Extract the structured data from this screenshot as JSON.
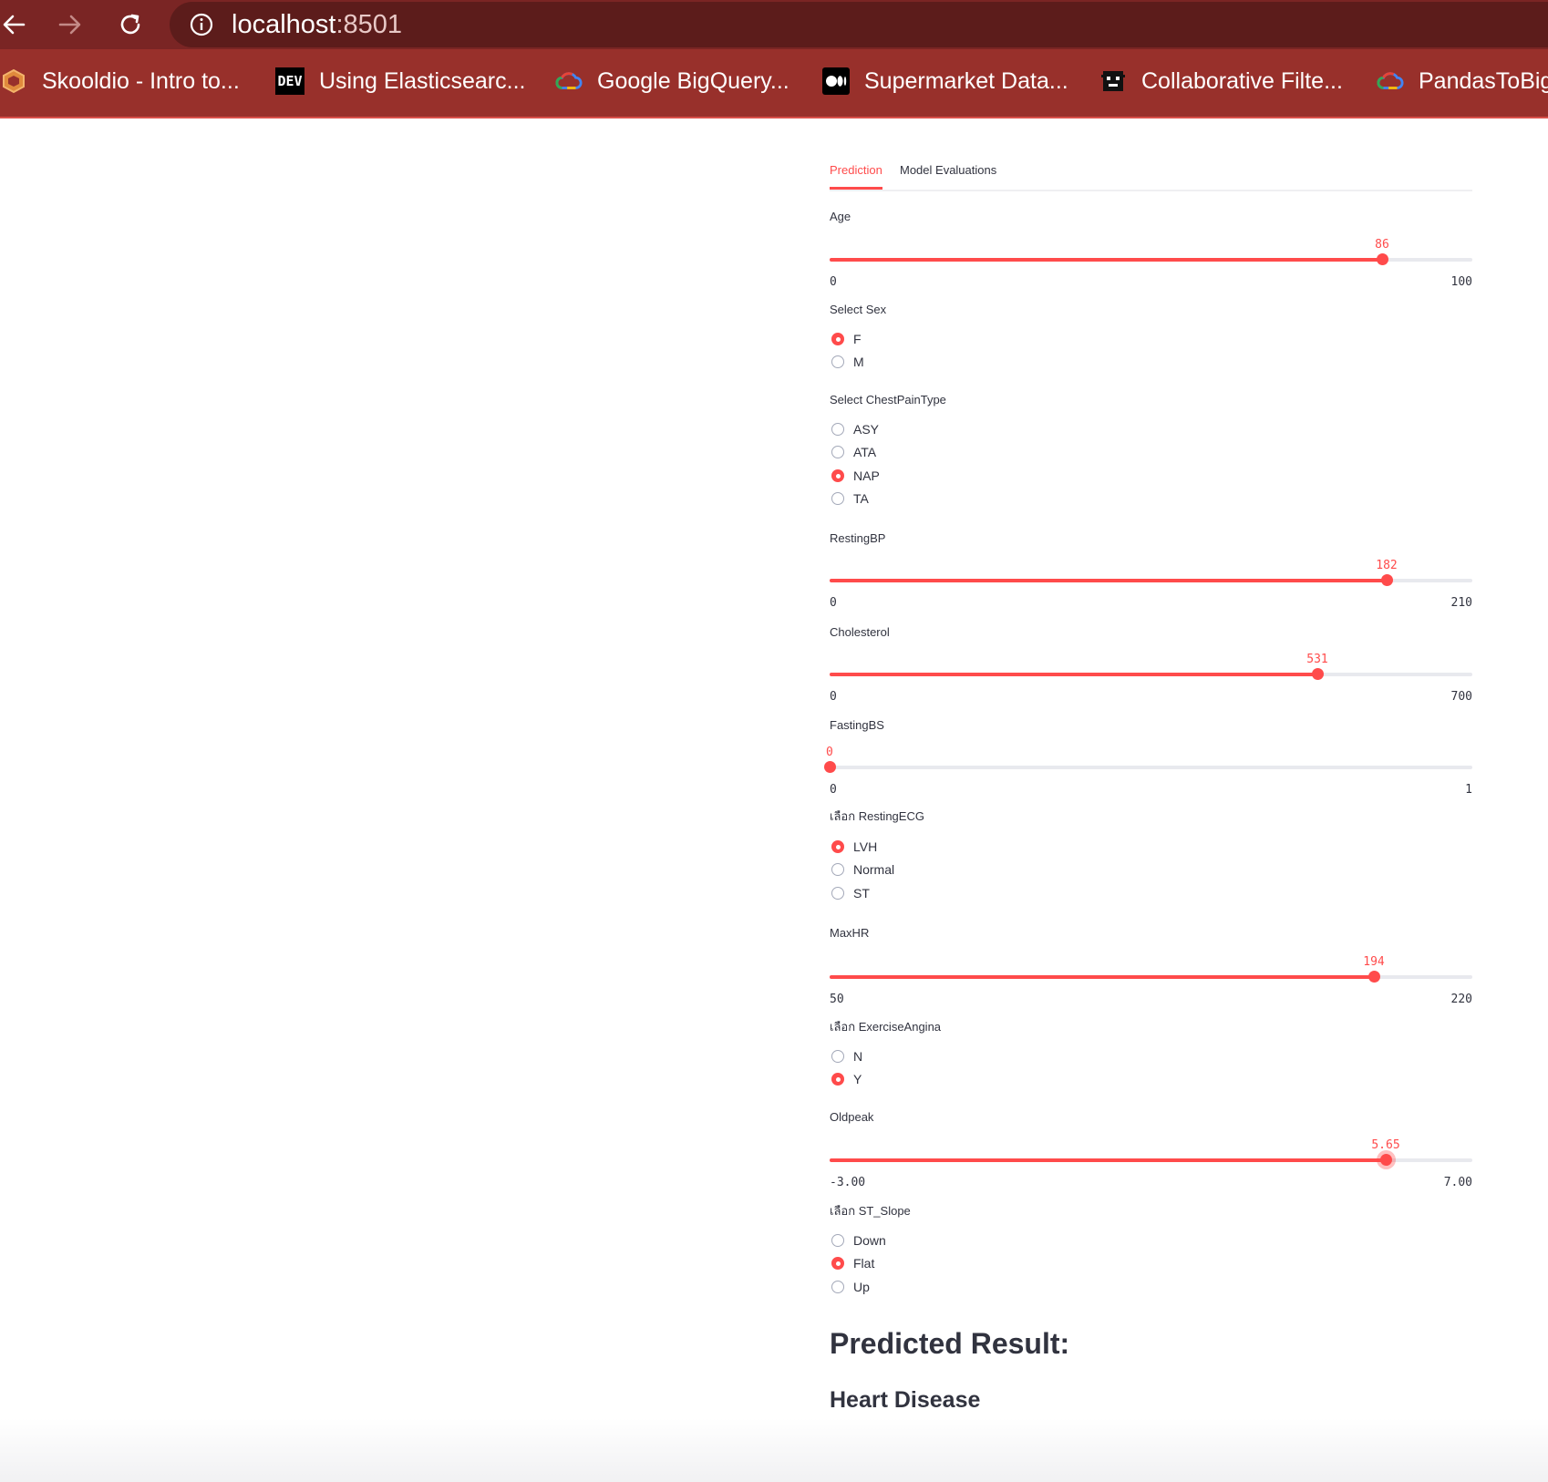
{
  "browser": {
    "url_host": "localhost",
    "url_port": ":8501",
    "bookmarks": [
      {
        "label": "Skooldio - Intro to...",
        "icon": "skooldio-icon"
      },
      {
        "label": "Using Elasticsearc...",
        "icon": "dev-icon",
        "icon_text": "DEV"
      },
      {
        "label": "Google BigQuery...",
        "icon": "google-cloud-icon"
      },
      {
        "label": "Supermarket Data...",
        "icon": "medium-icon"
      },
      {
        "label": "Collaborative Filte...",
        "icon": "pixel-avatar-icon"
      },
      {
        "label": "PandasToBig",
        "icon": "google-cloud-icon"
      }
    ]
  },
  "tabs": [
    {
      "label": "Prediction",
      "active": true
    },
    {
      "label": "Model Evaluations",
      "active": false
    }
  ],
  "age": {
    "label": "Age",
    "value": "86",
    "min": "0",
    "max": "100",
    "fraction": 0.86
  },
  "sex": {
    "label": "Select Sex",
    "options": [
      "F",
      "M"
    ],
    "selected": 0
  },
  "chest_pain": {
    "label": "Select ChestPainType",
    "options": [
      "ASY",
      "ATA",
      "NAP",
      "TA"
    ],
    "selected": 2
  },
  "resting_bp": {
    "label": "RestingBP",
    "value": "182",
    "min": "0",
    "max": "210",
    "fraction": 0.8667
  },
  "cholesterol": {
    "label": "Cholesterol",
    "value": "531",
    "min": "0",
    "max": "700",
    "fraction": 0.7586
  },
  "fasting_bs": {
    "label": "FastingBS",
    "value": "0",
    "min": "0",
    "max": "1",
    "fraction": 0
  },
  "resting_ecg": {
    "label": "เลือก RestingECG",
    "options": [
      "LVH",
      "Normal",
      "ST"
    ],
    "selected": 0
  },
  "max_hr": {
    "label": "MaxHR",
    "value": "194",
    "min": "50",
    "max": "220",
    "fraction": 0.8471
  },
  "exercise_angina": {
    "label": "เลือก ExerciseAngina",
    "options": [
      "N",
      "Y"
    ],
    "selected": 1
  },
  "oldpeak": {
    "label": "Oldpeak",
    "value": "5.65",
    "min": "-3.00",
    "max": "7.00",
    "fraction": 0.865
  },
  "st_slope": {
    "label": "เลือก ST_Slope",
    "options": [
      "Down",
      "Flat",
      "Up"
    ],
    "selected": 1
  },
  "result": {
    "heading": "Predicted Result:",
    "value": "Heart Disease"
  },
  "colors": {
    "accent": "#ff4b4b",
    "chrome_top": "#7a2524",
    "chrome_bookmarks": "#98302b"
  }
}
